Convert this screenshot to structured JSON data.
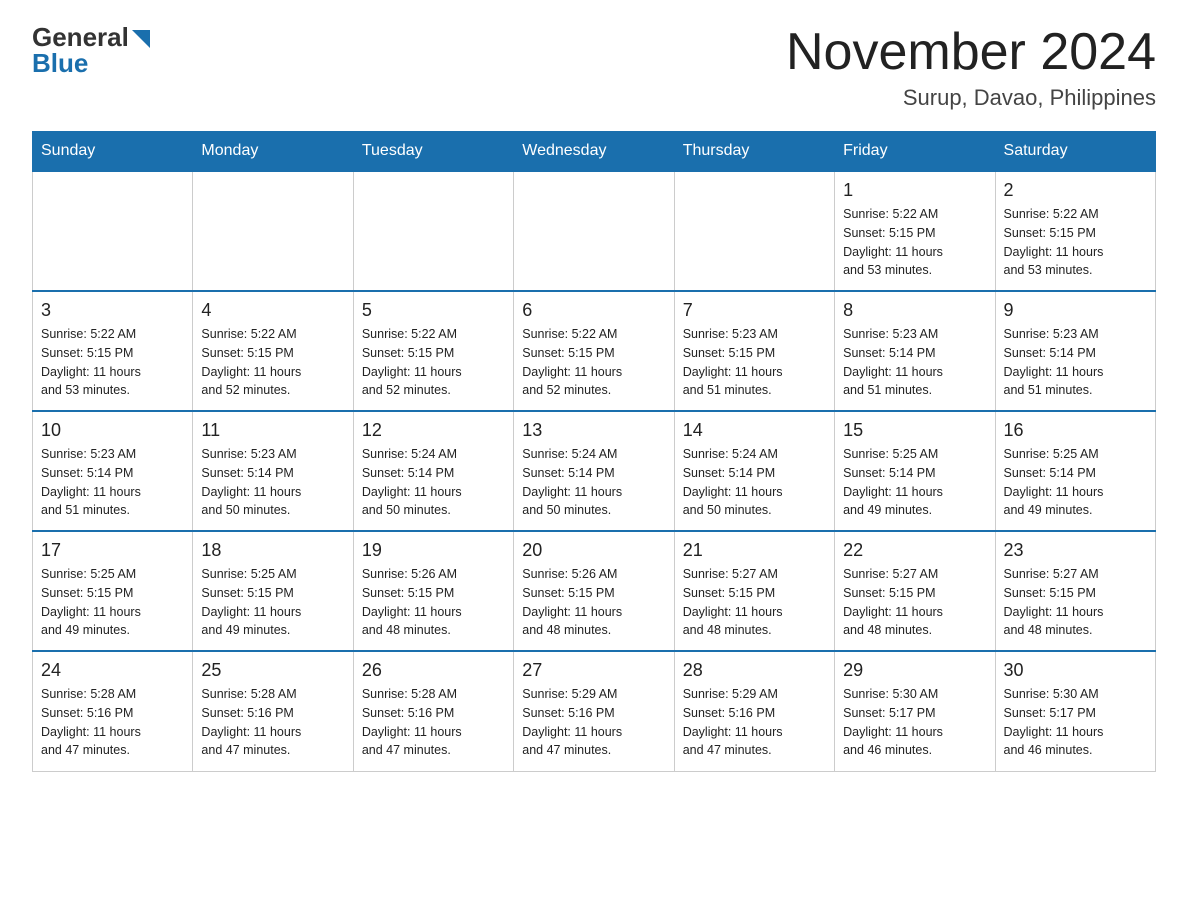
{
  "logo": {
    "general": "General",
    "blue": "Blue",
    "arrow_color": "#1a6fad"
  },
  "header": {
    "month_year": "November 2024",
    "location": "Surup, Davao, Philippines"
  },
  "days_of_week": [
    "Sunday",
    "Monday",
    "Tuesday",
    "Wednesday",
    "Thursday",
    "Friday",
    "Saturday"
  ],
  "weeks": [
    [
      {
        "day": "",
        "info": ""
      },
      {
        "day": "",
        "info": ""
      },
      {
        "day": "",
        "info": ""
      },
      {
        "day": "",
        "info": ""
      },
      {
        "day": "",
        "info": ""
      },
      {
        "day": "1",
        "info": "Sunrise: 5:22 AM\nSunset: 5:15 PM\nDaylight: 11 hours\nand 53 minutes."
      },
      {
        "day": "2",
        "info": "Sunrise: 5:22 AM\nSunset: 5:15 PM\nDaylight: 11 hours\nand 53 minutes."
      }
    ],
    [
      {
        "day": "3",
        "info": "Sunrise: 5:22 AM\nSunset: 5:15 PM\nDaylight: 11 hours\nand 53 minutes."
      },
      {
        "day": "4",
        "info": "Sunrise: 5:22 AM\nSunset: 5:15 PM\nDaylight: 11 hours\nand 52 minutes."
      },
      {
        "day": "5",
        "info": "Sunrise: 5:22 AM\nSunset: 5:15 PM\nDaylight: 11 hours\nand 52 minutes."
      },
      {
        "day": "6",
        "info": "Sunrise: 5:22 AM\nSunset: 5:15 PM\nDaylight: 11 hours\nand 52 minutes."
      },
      {
        "day": "7",
        "info": "Sunrise: 5:23 AM\nSunset: 5:15 PM\nDaylight: 11 hours\nand 51 minutes."
      },
      {
        "day": "8",
        "info": "Sunrise: 5:23 AM\nSunset: 5:14 PM\nDaylight: 11 hours\nand 51 minutes."
      },
      {
        "day": "9",
        "info": "Sunrise: 5:23 AM\nSunset: 5:14 PM\nDaylight: 11 hours\nand 51 minutes."
      }
    ],
    [
      {
        "day": "10",
        "info": "Sunrise: 5:23 AM\nSunset: 5:14 PM\nDaylight: 11 hours\nand 51 minutes."
      },
      {
        "day": "11",
        "info": "Sunrise: 5:23 AM\nSunset: 5:14 PM\nDaylight: 11 hours\nand 50 minutes."
      },
      {
        "day": "12",
        "info": "Sunrise: 5:24 AM\nSunset: 5:14 PM\nDaylight: 11 hours\nand 50 minutes."
      },
      {
        "day": "13",
        "info": "Sunrise: 5:24 AM\nSunset: 5:14 PM\nDaylight: 11 hours\nand 50 minutes."
      },
      {
        "day": "14",
        "info": "Sunrise: 5:24 AM\nSunset: 5:14 PM\nDaylight: 11 hours\nand 50 minutes."
      },
      {
        "day": "15",
        "info": "Sunrise: 5:25 AM\nSunset: 5:14 PM\nDaylight: 11 hours\nand 49 minutes."
      },
      {
        "day": "16",
        "info": "Sunrise: 5:25 AM\nSunset: 5:14 PM\nDaylight: 11 hours\nand 49 minutes."
      }
    ],
    [
      {
        "day": "17",
        "info": "Sunrise: 5:25 AM\nSunset: 5:15 PM\nDaylight: 11 hours\nand 49 minutes."
      },
      {
        "day": "18",
        "info": "Sunrise: 5:25 AM\nSunset: 5:15 PM\nDaylight: 11 hours\nand 49 minutes."
      },
      {
        "day": "19",
        "info": "Sunrise: 5:26 AM\nSunset: 5:15 PM\nDaylight: 11 hours\nand 48 minutes."
      },
      {
        "day": "20",
        "info": "Sunrise: 5:26 AM\nSunset: 5:15 PM\nDaylight: 11 hours\nand 48 minutes."
      },
      {
        "day": "21",
        "info": "Sunrise: 5:27 AM\nSunset: 5:15 PM\nDaylight: 11 hours\nand 48 minutes."
      },
      {
        "day": "22",
        "info": "Sunrise: 5:27 AM\nSunset: 5:15 PM\nDaylight: 11 hours\nand 48 minutes."
      },
      {
        "day": "23",
        "info": "Sunrise: 5:27 AM\nSunset: 5:15 PM\nDaylight: 11 hours\nand 48 minutes."
      }
    ],
    [
      {
        "day": "24",
        "info": "Sunrise: 5:28 AM\nSunset: 5:16 PM\nDaylight: 11 hours\nand 47 minutes."
      },
      {
        "day": "25",
        "info": "Sunrise: 5:28 AM\nSunset: 5:16 PM\nDaylight: 11 hours\nand 47 minutes."
      },
      {
        "day": "26",
        "info": "Sunrise: 5:28 AM\nSunset: 5:16 PM\nDaylight: 11 hours\nand 47 minutes."
      },
      {
        "day": "27",
        "info": "Sunrise: 5:29 AM\nSunset: 5:16 PM\nDaylight: 11 hours\nand 47 minutes."
      },
      {
        "day": "28",
        "info": "Sunrise: 5:29 AM\nSunset: 5:16 PM\nDaylight: 11 hours\nand 47 minutes."
      },
      {
        "day": "29",
        "info": "Sunrise: 5:30 AM\nSunset: 5:17 PM\nDaylight: 11 hours\nand 46 minutes."
      },
      {
        "day": "30",
        "info": "Sunrise: 5:30 AM\nSunset: 5:17 PM\nDaylight: 11 hours\nand 46 minutes."
      }
    ]
  ],
  "accent_color": "#1a6fad"
}
